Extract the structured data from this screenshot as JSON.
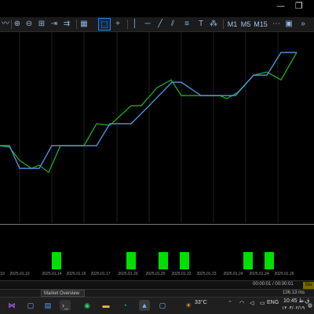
{
  "titlebar": {
    "minimize_glyph": "—",
    "restore_glyph": "❐"
  },
  "toolbar": {
    "icons": [
      "line-icon",
      "crosshair-icon",
      "zoom-in-icon",
      "zoom-out-icon",
      "grid-icon",
      "chart-shift-icon",
      "chart-scroll-icon",
      "cursor-icon",
      "crosshair-tool-icon",
      "vertical-line-icon",
      "horizontal-line-icon",
      "trendline-icon",
      "channel-icon",
      "text-icon",
      "shapes-icon"
    ],
    "timeframes": [
      "M1",
      "M5",
      "M15"
    ]
  },
  "chart_data": {
    "type": "line",
    "x": [
      "2025.01.10",
      "2025.01.10",
      "2025.01.14",
      "2025.01.16",
      "2025.01.17",
      "2025.01.20",
      "2025.01.20",
      "2025.01.22",
      "2025.01.23",
      "2025.01.24",
      "2025.01.24",
      "2025.01.28"
    ],
    "series": [
      {
        "color": "#4a90d9",
        "values": [
          186,
          186,
          215,
          215,
          186,
          186,
          186,
          158,
          158,
          135,
          105,
          105,
          122,
          122,
          122,
          96,
          96,
          67,
          67
        ]
      },
      {
        "color": "#1fa01f",
        "values": [
          186,
          188,
          205,
          215,
          211,
          220,
          186,
          186,
          186,
          158,
          160,
          135,
          135,
          112,
          102,
          122,
          122,
          122,
          126,
          118,
          96,
          92,
          102,
          67
        ]
      },
      {
        "color": "#00e000",
        "bar_positions": [
          72,
          167,
          208,
          235,
          316,
          343
        ],
        "bar_height": 1
      }
    ],
    "x_tick_labels": [
      "19",
      "2025.01.10",
      "2025.01.14",
      "2025.01.16",
      "2025.01.17",
      "2025.01.20",
      "2025.01.20",
      "2025.01.22",
      "2025.01.23",
      "2025.01.24",
      "2025.01.24",
      "2025.01.26"
    ]
  },
  "statusbar": {
    "time_range": "00:00:01 / 00:00:01",
    "button": "Sto"
  },
  "market_window": {
    "tab_label": "Market Overview",
    "network": "136.13 ms"
  },
  "taskbar": {
    "apps": [
      "visual-studio-icon",
      "store-icon",
      "calendar-icon",
      "terminal-icon",
      "whatsapp-icon",
      "file-explorer-icon",
      "mt-icon",
      "phone-link-icon"
    ],
    "weather": "33°C",
    "language": "ENG",
    "time": "10:45 ق.ظ",
    "date": "۱۴۰۴/۰۲/۱۹"
  }
}
